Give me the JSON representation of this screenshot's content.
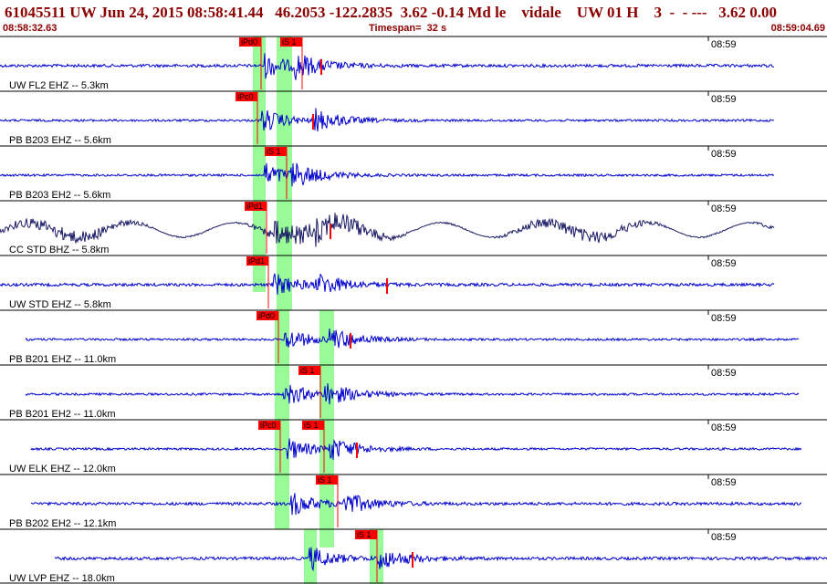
{
  "header": {
    "title": "61045511 UW Jun 24, 2015 08:58:41.44   46.2053 -122.2835  3.62 -0.14 Md le    vidale    UW 01 H    3  -  - ---   3.62 0.00",
    "start_time": "08:58:32.63",
    "timespan": "Timespan=  32 s",
    "end_time": "08:59:04.69"
  },
  "colors": {
    "title": "#8b0000",
    "trace": "#0000cc",
    "trace_bb": "#1a1a66",
    "pick_box": "#ff0000",
    "window": "#98fb98"
  },
  "channels": [
    {
      "label": "UW FL2 EHZ -- 5.3km",
      "tick": "08:59",
      "picks": [
        "iPd0",
        "iS 1"
      ]
    },
    {
      "label": "PB B203 EHZ -- 5.6km",
      "tick": "08:59",
      "picks": [
        "iPc0"
      ]
    },
    {
      "label": "PB B203 EH2 -- 5.6km",
      "tick": "08:59",
      "picks": [
        "iS 1"
      ]
    },
    {
      "label": "CC STD BHZ -- 5.8km",
      "tick": "08:59",
      "picks": [
        "iPd1"
      ]
    },
    {
      "label": "UW STD EHZ -- 5.8km",
      "tick": "08:59",
      "picks": [
        "iPd1"
      ]
    },
    {
      "label": "PB B201 EHZ -- 11.0km",
      "tick": "08:59",
      "picks": [
        "iPd0"
      ]
    },
    {
      "label": "PB B201 EH2 -- 11.0km",
      "tick": "08:59",
      "picks": [
        "iS 1"
      ]
    },
    {
      "label": "UW ELK EHZ -- 12.0km",
      "tick": "08:59",
      "picks": [
        "iPc0",
        "iS 1"
      ]
    },
    {
      "label": "PB B202 EH2 -- 12.1km",
      "tick": "08:59",
      "picks": [
        "iS 1"
      ]
    },
    {
      "label": "UW LVP EHZ -- 18.0km",
      "tick": "08:59",
      "picks": [
        "iS 1"
      ]
    }
  ]
}
